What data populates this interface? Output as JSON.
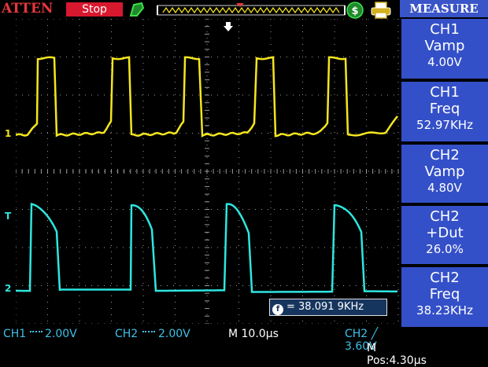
{
  "top_bar": {
    "atten_label": "ATTEN",
    "run_state": "Stop",
    "icons": [
      "trigger-run-icon",
      "memory-position-bar",
      "usb-icon",
      "printer-icon"
    ]
  },
  "colors": {
    "ch1": "#f5e61e",
    "ch2": "#2ee6e0",
    "grid": "#9a9a9a",
    "panel": "#3450c8",
    "stop": "#d8182e",
    "atten": "#e8383b",
    "status_text": "#3ec1e8"
  },
  "measure": {
    "title": "MEASURE",
    "items": [
      {
        "source": "CH1",
        "type": "Vamp",
        "value": "4.00V"
      },
      {
        "source": "CH1",
        "type": "Freq",
        "value": "52.97KHz"
      },
      {
        "source": "CH2",
        "type": "Vamp",
        "value": "4.80V"
      },
      {
        "source": "CH2",
        "type": "+Dut",
        "value": "26.0%"
      },
      {
        "source": "CH2",
        "type": "Freq",
        "value": "38.23KHz"
      }
    ]
  },
  "freq_counter": {
    "value": "= 38.091 9KHz"
  },
  "markers": {
    "ch1": "1",
    "ch2": "2",
    "trigger": "T"
  },
  "status": {
    "ch1_scale": "CH1",
    "ch1_value": "2.00V",
    "ch2_scale": "CH2",
    "ch2_value": "2.00V",
    "timebase": "M 10.0µs",
    "trigger": "CH2 ╱ 3.60V",
    "mpos": "M Pos:4.30µs"
  }
}
